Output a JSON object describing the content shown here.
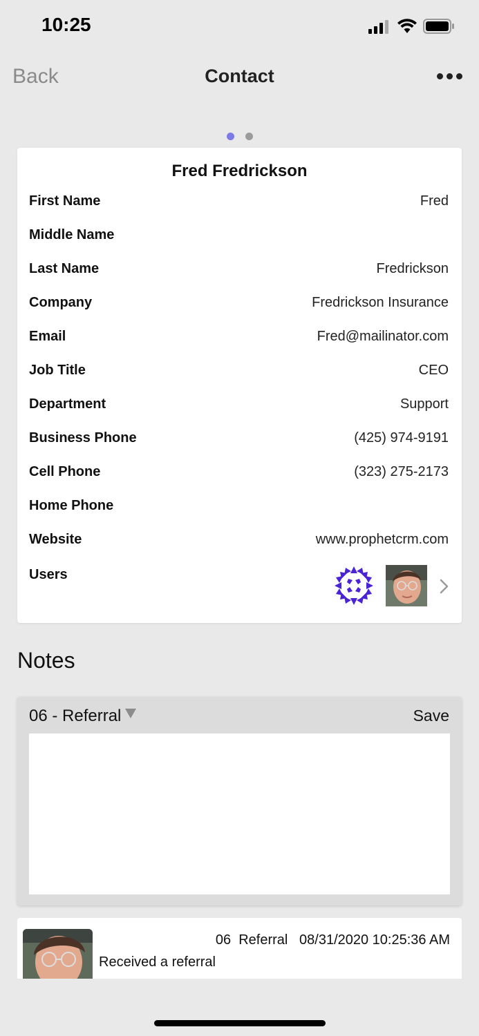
{
  "status_bar": {
    "time": "10:25"
  },
  "nav": {
    "back_label": "Back",
    "title": "Contact"
  },
  "contact": {
    "full_name": "Fred Fredrickson",
    "fields": [
      {
        "label": "First Name",
        "value": "Fred"
      },
      {
        "label": "Middle Name",
        "value": ""
      },
      {
        "label": "Last Name",
        "value": "Fredrickson"
      },
      {
        "label": "Company",
        "value": "Fredrickson Insurance"
      },
      {
        "label": "Email",
        "value": "Fred@mailinator.com"
      },
      {
        "label": "Job Title",
        "value": "CEO"
      },
      {
        "label": "Department",
        "value": "Support"
      },
      {
        "label": "Business Phone",
        "value": "(425) 974-9191"
      },
      {
        "label": "Cell Phone",
        "value": "(323) 275-2173"
      },
      {
        "label": "Home Phone",
        "value": ""
      },
      {
        "label": "Website",
        "value": "www.prophetcrm.com"
      }
    ],
    "users_label": "Users"
  },
  "notes": {
    "heading": "Notes",
    "editor": {
      "note_type": "06 - Referral",
      "save_label": "Save",
      "text": ""
    },
    "items": [
      {
        "type_code": "06",
        "type_name": "Referral",
        "timestamp": "08/31/2020 10:25:36 AM",
        "text": "Received a referral"
      }
    ]
  },
  "colors": {
    "active_dot": "#7b7be6",
    "org_logo": "#4b23d6",
    "background": "#e9e9e9"
  }
}
